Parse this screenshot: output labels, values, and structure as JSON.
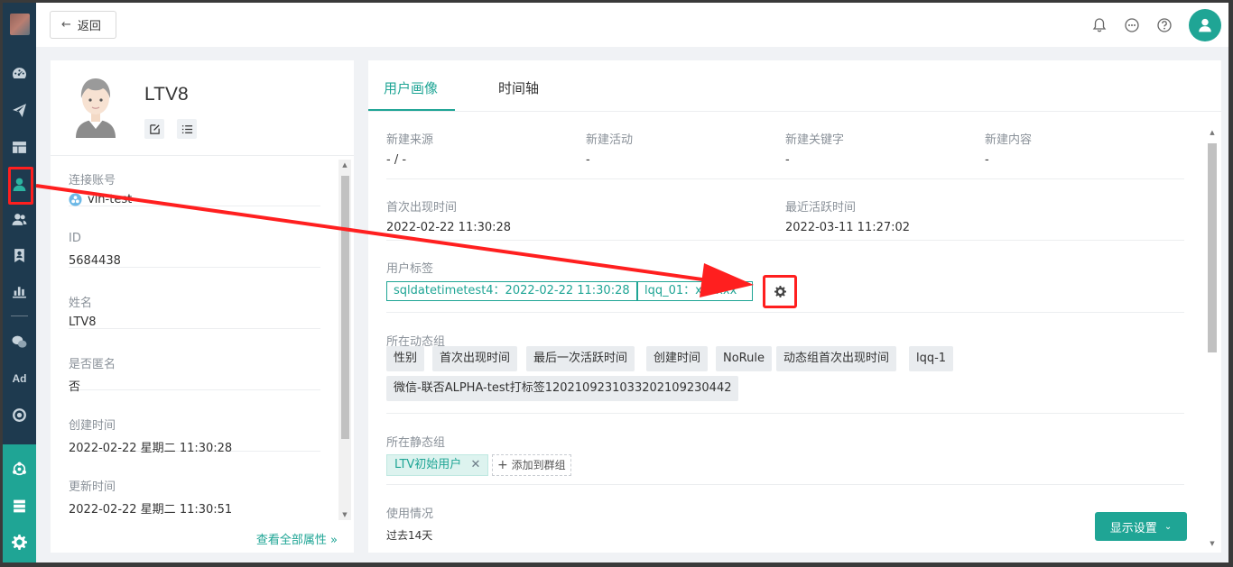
{
  "topbar": {
    "back_label": "返回"
  },
  "profile": {
    "name": "LTV8",
    "see_all": "查看全部属性",
    "attributes": [
      {
        "label": "连接账号",
        "value": "vin-test"
      },
      {
        "label": "ID",
        "value": "5684438"
      },
      {
        "label": "姓名",
        "value": "LTV8"
      },
      {
        "label": "是否匿名",
        "value": "否"
      },
      {
        "label": "创建时间",
        "value": "2022-02-22 星期二 11:30:28"
      },
      {
        "label": "更新时间",
        "value": "2022-02-22 星期二 11:30:51"
      }
    ]
  },
  "tabs": [
    {
      "label": "用户画像"
    },
    {
      "label": "时间轴"
    }
  ],
  "overview": {
    "source": {
      "label": "新建来源",
      "value": "- / -"
    },
    "activity": {
      "label": "新建活动",
      "value": "-"
    },
    "keyword": {
      "label": "新建关键字",
      "value": "-"
    },
    "content": {
      "label": "新建内容",
      "value": "-"
    },
    "first_seen": {
      "label": "首次出现时间",
      "value": "2022-02-22 11:30:28"
    },
    "last_active": {
      "label": "最近活跃时间",
      "value": "2022-03-11 11:27:02"
    }
  },
  "user_tags": {
    "label": "用户标签",
    "tags": [
      "sqldatetimetest4：2022-02-22 11:30:28",
      "lqq_01：xxxxxx"
    ]
  },
  "dynamic_groups": {
    "label": "所在动态组",
    "items": [
      "性别",
      "首次出现时间",
      "最后一次活跃时间",
      "创建时间",
      "NoRule",
      "动态组首次出现时间",
      "lqq-1",
      "微信-联否ALPHA-test打标签120210923103320210923044​2"
    ]
  },
  "static_groups": {
    "label": "所在静态组",
    "items": [
      "LTV初始用户"
    ],
    "add_label": "添加到群组"
  },
  "usage": {
    "label": "使用情况",
    "period": "过去14天",
    "display_btn": "显示设置"
  },
  "colors": {
    "accent": "#1fa595",
    "sidebar": "#1e3a4f",
    "annotation": "#ff1f1f"
  }
}
